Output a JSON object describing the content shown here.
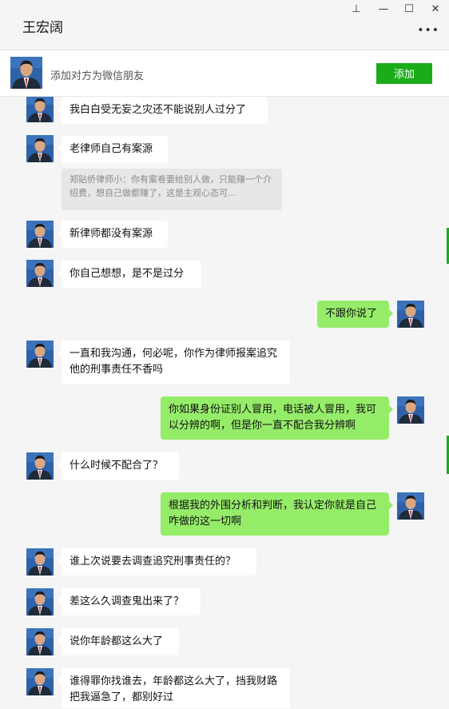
{
  "window": {
    "title": "王宏阔",
    "controls": [
      {
        "name": "pin-icon",
        "glyph": "⊥"
      },
      {
        "name": "minimize-icon",
        "glyph": "—"
      },
      {
        "name": "maximize-icon",
        "glyph": "☐"
      },
      {
        "name": "close-icon",
        "glyph": "✕"
      }
    ],
    "more_glyph": "•••"
  },
  "add_bar": {
    "hint": "添加对方为微信朋友",
    "button_label": "添加"
  },
  "colors": {
    "brand_green": "#1aad19",
    "outgoing_bubble": "#95ec69",
    "incoming_bubble": "#ffffff"
  },
  "messages": [
    {
      "from": "other",
      "text": "我白白受无妄之灾还不能说别人过分了"
    },
    {
      "from": "other",
      "text": "老律师自己有案源"
    },
    {
      "from": "quote",
      "text": "郑贴侨律师小：你有案卷要给别人做，只能赚一个介绍费，想自己做都赚了，这是主观心态可..."
    },
    {
      "from": "other",
      "text": "新律师都没有案源"
    },
    {
      "from": "other",
      "text": "你自己想想，是不是过分"
    },
    {
      "from": "me",
      "text": "不跟你说了"
    },
    {
      "from": "other",
      "text": "一直和我沟通，何必呢，你作为律师报案追究他的刑事责任不香吗"
    },
    {
      "from": "me",
      "text": "你如果身份证别人冒用，电话被人冒用，我可以分辨的啊，但是你一直不配合我分辨啊"
    },
    {
      "from": "other",
      "text": "什么时候不配合了？"
    },
    {
      "from": "me",
      "text": "根据我的外围分析和判断，我认定你就是自己咋做的这一切啊"
    },
    {
      "from": "other",
      "text": "谁上次说要去调查追究刑事责任的？"
    },
    {
      "from": "other",
      "text": "差这么久调查鬼出来了？"
    },
    {
      "from": "other",
      "text": "说你年龄都这么大了"
    },
    {
      "from": "other",
      "text": "谁得罪你找谁去，年龄都这么大了，挡我财路把我逼急了，都别好过"
    }
  ]
}
